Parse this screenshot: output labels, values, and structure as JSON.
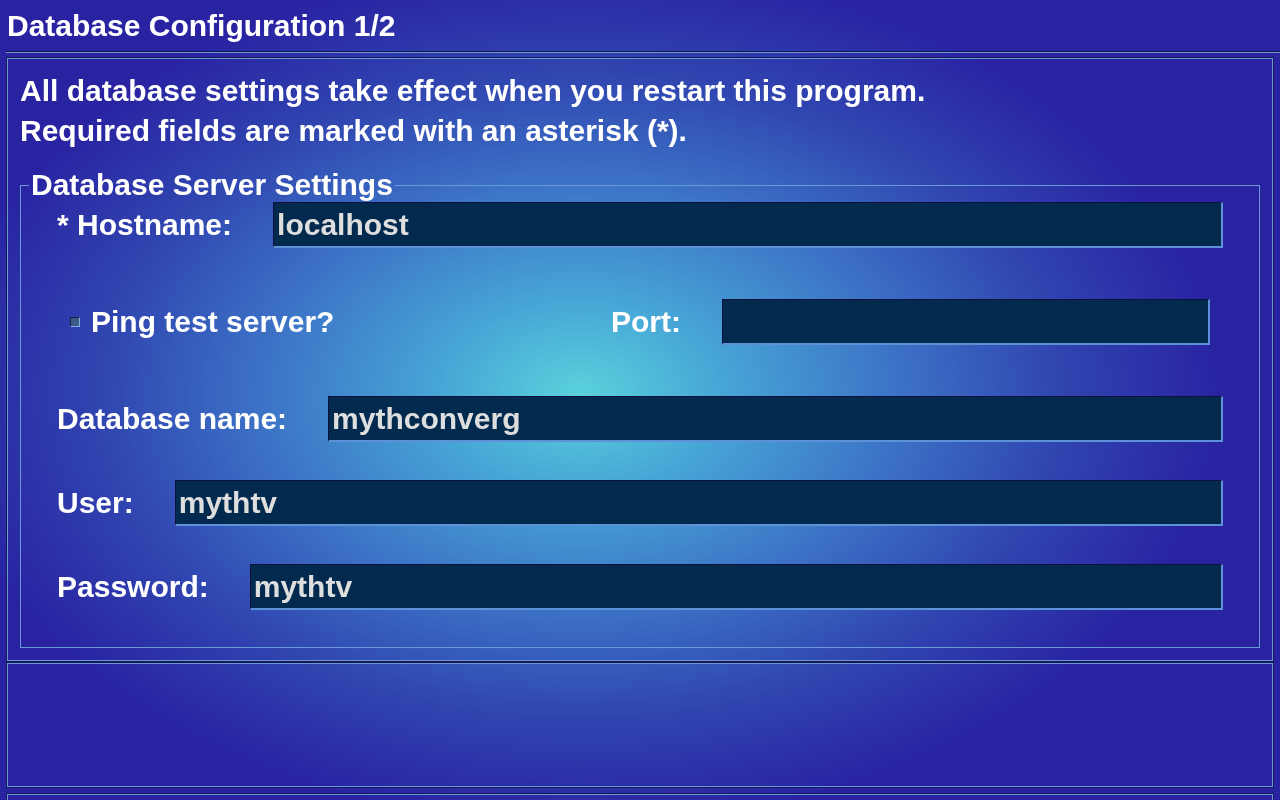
{
  "window": {
    "title": "Database Configuration 1/2"
  },
  "intro": [
    "All database settings take effect when you restart this program.",
    "Required fields are marked with an asterisk (*)."
  ],
  "group": {
    "title": "Database Server Settings",
    "rows": [
      {
        "kind": "field",
        "label": "* Hostname:",
        "value": "localhost"
      },
      {
        "kind": "check_field",
        "check": {
          "label": "Ping test server?",
          "checked": false
        },
        "label": "Port:"
      },
      {
        "kind": "field",
        "label": "Database name:",
        "value": "mythconverg"
      },
      {
        "kind": "field",
        "label": "User:",
        "value": "mythtv"
      },
      {
        "kind": "field",
        "label": "Password:",
        "value": "mythtv"
      }
    ]
  }
}
